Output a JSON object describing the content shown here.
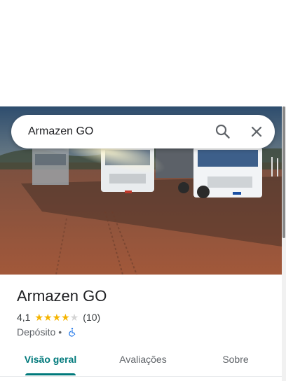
{
  "search": {
    "query": "Armazen GO",
    "search_icon": "search-icon",
    "close_icon": "close-icon"
  },
  "place": {
    "name": "Armazen GO",
    "rating": "4,1",
    "stars_filled": 4,
    "stars_total": 5,
    "review_count": "(10)",
    "category": "Depósito",
    "separator": "•",
    "accessibility_icon": "wheelchair-icon"
  },
  "tabs": [
    {
      "label": "Visão geral",
      "active": true
    },
    {
      "label": "Avaliações",
      "active": false
    },
    {
      "label": "Sobre",
      "active": false
    }
  ],
  "colors": {
    "accent": "#00797b",
    "star": "#f5b400",
    "star_empty": "#d4d4d4",
    "accessibility": "#1a73e8"
  }
}
